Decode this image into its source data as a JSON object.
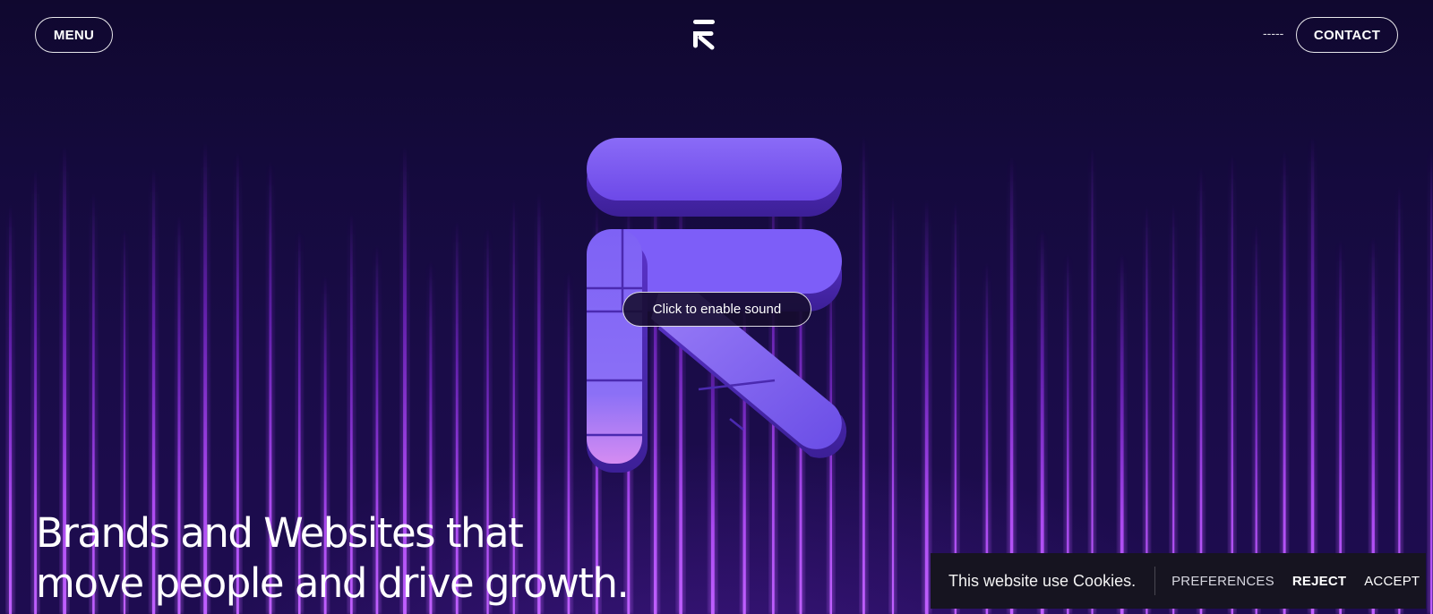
{
  "header": {
    "menu_label": "MENU",
    "contact_dash": "-----",
    "contact_label": "CONTACT",
    "logo_icon": "brand-r-arrow-logo"
  },
  "hero": {
    "sound_label": "Click to enable sound",
    "headline_line1": "Brands and Websites that",
    "headline_line2": "move people and drive growth."
  },
  "cookies": {
    "message": "This website use Cookies.",
    "preferences_label": "PREFERENCES",
    "reject_label": "REJECT",
    "accept_label": "ACCEPT"
  },
  "colors": {
    "background": "#120a36",
    "accent_purple": "#7b5cf5",
    "light_line": "#a23cf0",
    "cookie_bar": "#161420"
  }
}
